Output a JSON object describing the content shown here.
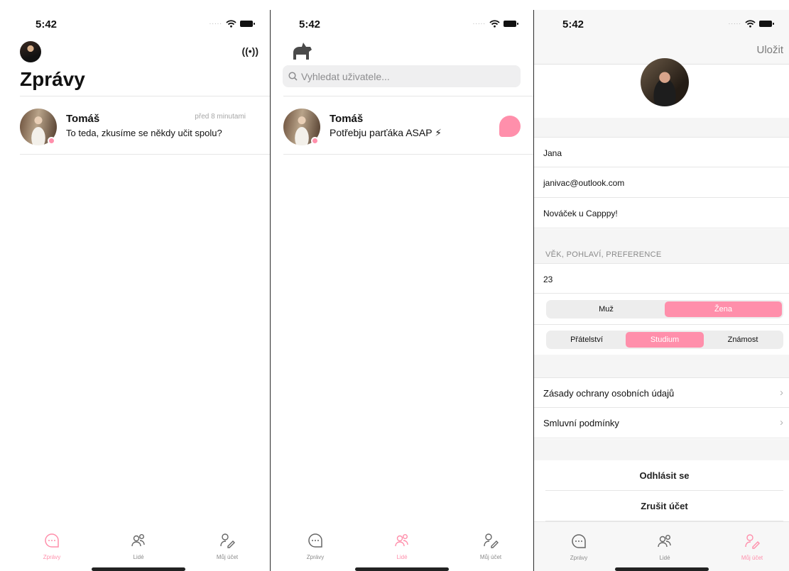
{
  "screens": {
    "messages": {
      "time": "5:42",
      "title": "Zprávy",
      "chat": {
        "name": "Tomáš",
        "time_ago": "před 8 minutami",
        "message": "To teda, zkusíme se někdy učit spolu?"
      },
      "tabs": [
        {
          "label": "Zprávy",
          "icon": "chat-icon"
        },
        {
          "label": "Lidé",
          "icon": "people-icon"
        },
        {
          "label": "Můj účet",
          "icon": "account-icon"
        }
      ],
      "active_tab": "Zprávy"
    },
    "people": {
      "time": "5:42",
      "search_placeholder": "Vyhledat uživatele...",
      "person": {
        "name": "Tomáš",
        "status": "Potřebju parťáka ASAP ⚡"
      },
      "tabs": [
        {
          "label": "Zprávy",
          "icon": "chat-icon"
        },
        {
          "label": "Lidé",
          "icon": "people-icon"
        },
        {
          "label": "Můj účet",
          "icon": "account-icon"
        }
      ],
      "active_tab": "Lidé"
    },
    "account": {
      "time": "5:42",
      "save_label": "Uložit",
      "name": "Jana",
      "email": "janivac@outlook.com",
      "bio": "Nováček u Capppy!",
      "section_header": "VĚK, POHLAVÍ, PREFERENCE",
      "age": "23",
      "gender_options": [
        "Muž",
        "Žena"
      ],
      "gender_selected": "Žena",
      "preference_options": [
        "Přátelství",
        "Studium",
        "Známost"
      ],
      "preference_selected": "Studium",
      "links": [
        "Zásady ochrany osobních údajů",
        "Smluvní podmínky"
      ],
      "logout_label": "Odhlásit se",
      "delete_label": "Zrušit účet",
      "tabs": [
        {
          "label": "Zprávy",
          "icon": "chat-icon"
        },
        {
          "label": "Lidé",
          "icon": "people-icon"
        },
        {
          "label": "Můj účet",
          "icon": "account-icon"
        }
      ],
      "active_tab": "Můj účet"
    }
  },
  "colors": {
    "accent": "#ff8fab",
    "inactive": "#8b8b8b"
  }
}
